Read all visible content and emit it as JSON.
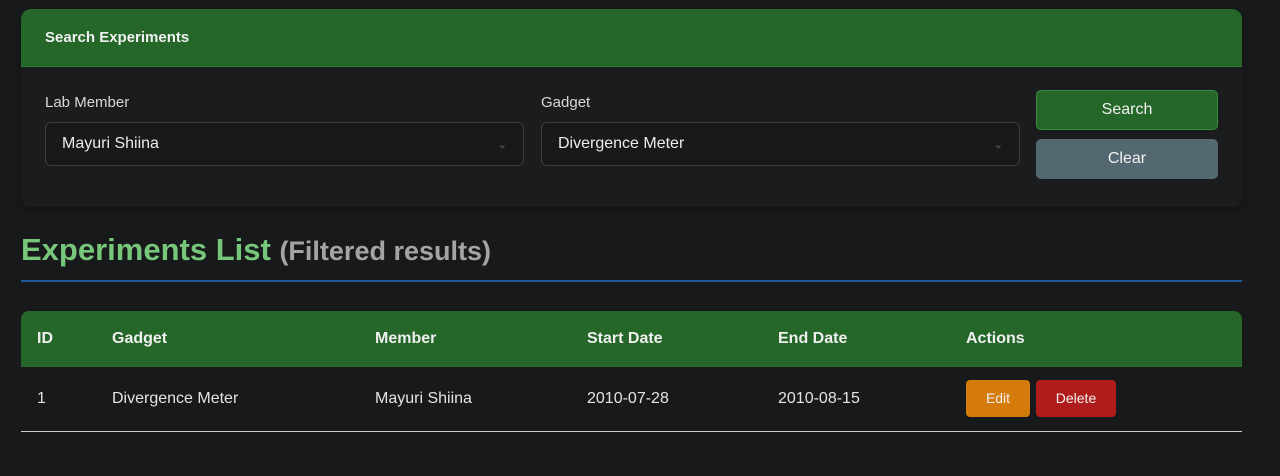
{
  "search_card": {
    "title": "Search Experiments",
    "lab_member_label": "Lab Member",
    "lab_member_value": "Mayuri Shiina",
    "gadget_label": "Gadget",
    "gadget_value": "Divergence Meter",
    "search_label": "Search",
    "clear_label": "Clear"
  },
  "list": {
    "title": "Experiments List",
    "subtitle": "(Filtered results)",
    "columns": [
      "ID",
      "Gadget",
      "Member",
      "Start Date",
      "End Date",
      "Actions"
    ],
    "rows": [
      {
        "id": "1",
        "gadget": "Divergence Meter",
        "member": "Mayuri Shiina",
        "start": "2010-07-28",
        "end": "2010-08-15",
        "edit": "Edit",
        "delete": "Delete"
      }
    ]
  },
  "colors": {
    "accent_green": "#256629",
    "title_green": "#76c77a",
    "edit": "#d47b0b",
    "delete": "#b01c1c",
    "clear": "#546872",
    "rule": "#1f5a9a"
  }
}
